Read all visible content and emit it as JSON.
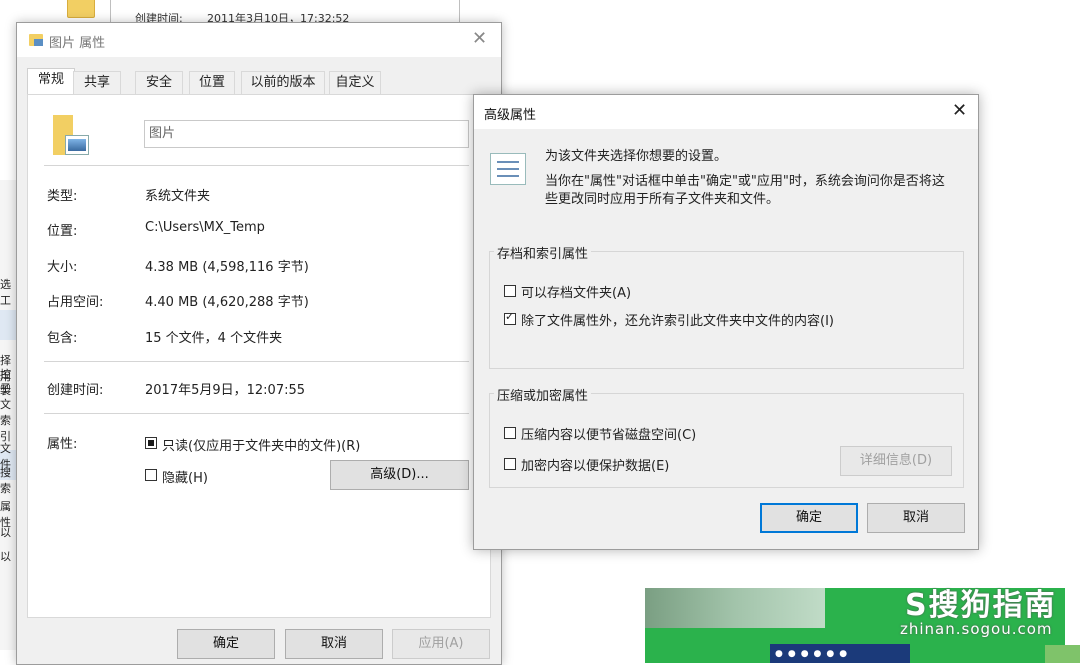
{
  "background": {
    "window_title_row": {
      "label": "创建时间:",
      "value": "2011年3月10日，17:32:52"
    },
    "left_fragments": [
      "选工",
      "择用",
      "控製",
      "子文",
      "索引",
      "文件",
      "搜索",
      "属性",
      "以",
      "以"
    ]
  },
  "properties_dialog": {
    "title": "图片 属性",
    "tabs": [
      "常规",
      "共享",
      "安全",
      "位置",
      "以前的版本",
      "自定义"
    ],
    "folder_name": "图片",
    "fields": [
      {
        "label": "类型:",
        "value": "系统文件夹"
      },
      {
        "label": "位置:",
        "value": "C:\\Users\\MX_Temp"
      },
      {
        "label": "大小:",
        "value": "4.38 MB (4,598,116 字节)"
      },
      {
        "label": "占用空间:",
        "value": "4.40 MB (4,620,288 字节)"
      },
      {
        "label": "包含:",
        "value": "15 个文件，4 个文件夹"
      },
      {
        "label": "创建时间:",
        "value": "2017年5月9日，12:07:55"
      }
    ],
    "attributes_label": "属性:",
    "readonly_label": "只读(仅应用于文件夹中的文件)(R)",
    "hidden_label": "隐藏(H)",
    "advanced_button": "高级(D)...",
    "ok_button": "确定",
    "cancel_button": "取消",
    "apply_button": "应用(A)"
  },
  "advanced_dialog": {
    "title": "高级属性",
    "desc_line1": "为该文件夹选择你想要的设置。",
    "desc_line2": "当你在\"属性\"对话框中单击\"确定\"或\"应用\"时，系统会询问你是否将这",
    "desc_line3": "些更改同时应用于所有子文件夹和文件。",
    "archive_group": "存档和索引属性",
    "archive_option": "可以存档文件夹(A)",
    "index_option": "除了文件属性外，还允许索引此文件夹中文件的内容(I)",
    "compress_group": "压缩或加密属性",
    "compress_option": "压缩内容以便节省磁盘空间(C)",
    "encrypt_option": "加密内容以便保护数据(E)",
    "details_button": "详细信息(D)",
    "ok_button": "确定",
    "cancel_button": "取消",
    "states": {
      "archive": false,
      "index": true,
      "compress": false,
      "encrypt": false
    }
  },
  "watermark": {
    "brand": "S搜狗指南",
    "url": "zhinan.sogou.com"
  }
}
